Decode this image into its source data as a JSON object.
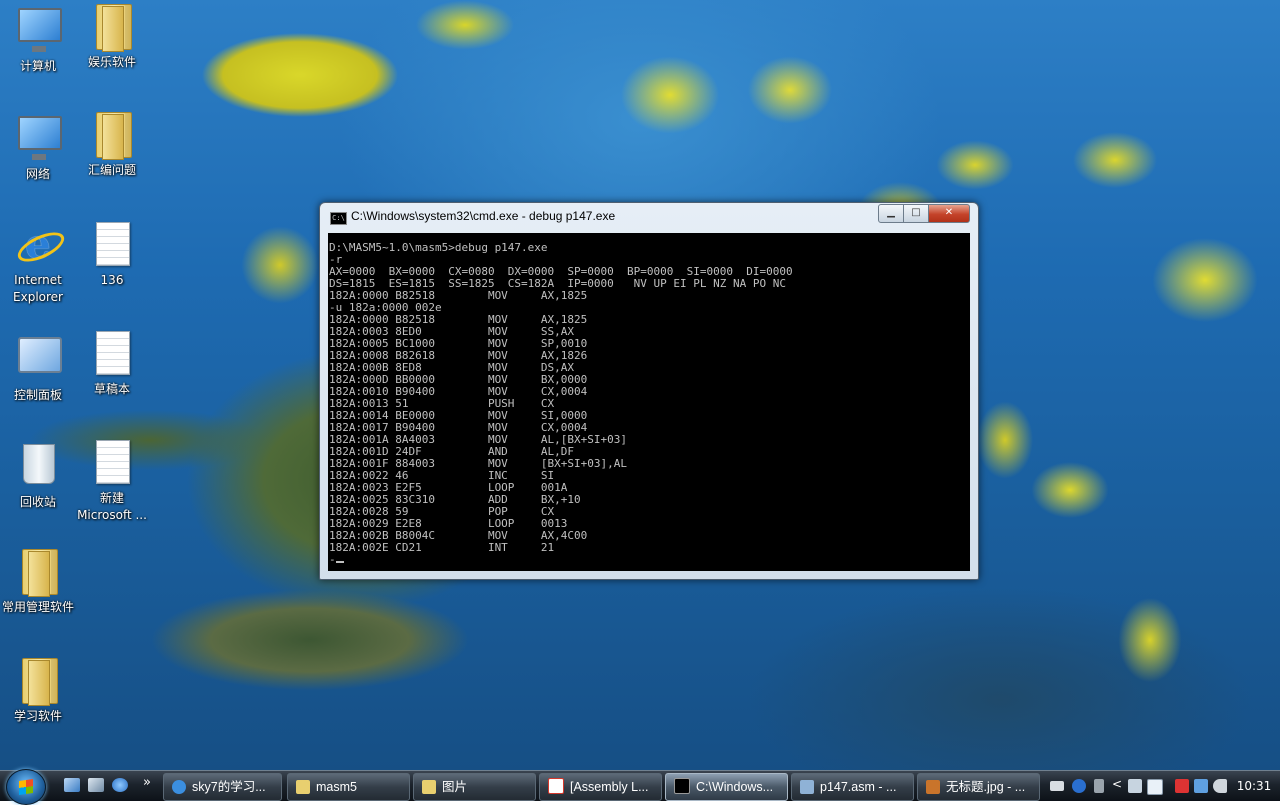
{
  "desktop": {
    "icons": [
      {
        "label": "计算机",
        "kind": "computer-icon"
      },
      {
        "label": "娱乐软件",
        "kind": "folder-icon"
      },
      {
        "label": "网络",
        "kind": "network-icon"
      },
      {
        "label": "汇编问题",
        "kind": "folder-icon"
      },
      {
        "label": "Internet Explorer",
        "kind": "internet-explorer-icon"
      },
      {
        "label": "136",
        "kind": "document-icon"
      },
      {
        "label": "控制面板",
        "kind": "control-panel-icon"
      },
      {
        "label": "草稿本",
        "kind": "document-icon"
      },
      {
        "label": "回收站",
        "kind": "recycle-bin-icon"
      },
      {
        "label": "新建 Microsoft ...",
        "kind": "word-document-icon"
      },
      {
        "label": "常用管理软件",
        "kind": "folder-icon"
      },
      {
        "label": "学习软件",
        "kind": "folder-icon"
      }
    ]
  },
  "cmd_window": {
    "title": "C:\\Windows\\system32\\cmd.exe - debug  p147.exe",
    "minimize_glyph": "▁",
    "maximize_glyph": "□",
    "close_glyph": "✕",
    "console_lines": [
      "D:\\MASM5~1.0\\masm5>debug p147.exe",
      "-r",
      "AX=0000  BX=0000  CX=0080  DX=0000  SP=0000  BP=0000  SI=0000  DI=0000",
      "DS=1815  ES=1815  SS=1825  CS=182A  IP=0000   NV UP EI PL NZ NA PO NC",
      "182A:0000 B82518        MOV     AX,1825",
      "-u 182a:0000 002e",
      "182A:0000 B82518        MOV     AX,1825",
      "182A:0003 8ED0          MOV     SS,AX",
      "182A:0005 BC1000        MOV     SP,0010",
      "182A:0008 B82618        MOV     AX,1826",
      "182A:000B 8ED8          MOV     DS,AX",
      "182A:000D BB0000        MOV     BX,0000",
      "182A:0010 B90400        MOV     CX,0004",
      "182A:0013 51            PUSH    CX",
      "182A:0014 BE0000        MOV     SI,0000",
      "182A:0017 B90400        MOV     CX,0004",
      "182A:001A 8A4003        MOV     AL,[BX+SI+03]",
      "182A:001D 24DF          AND     AL,DF",
      "182A:001F 884003        MOV     [BX+SI+03],AL",
      "182A:0022 46            INC     SI",
      "182A:0023 E2F5          LOOP    001A",
      "182A:0025 83C310        ADD     BX,+10",
      "182A:0028 59            POP     CX",
      "182A:0029 E2E8          LOOP    0013",
      "182A:002B B8004C        MOV     AX,4C00",
      "182A:002E CD21          INT     21",
      "-"
    ]
  },
  "taskbar": {
    "tasks": [
      {
        "label": "sky7的学习...",
        "color": "#3b8fe0"
      },
      {
        "label": "masm5",
        "color": "#e8cf6f"
      },
      {
        "label": "图片",
        "color": "#e8cf6f"
      },
      {
        "label": "[Assembly L...",
        "color": "#d4382c"
      },
      {
        "label": "C:\\Windows...",
        "color": "#000000",
        "active": true
      },
      {
        "label": "p147.asm - ...",
        "color": "#8fb2d6"
      },
      {
        "label": "无标题.jpg - ...",
        "color": "#c9742b"
      }
    ],
    "quicklaunch_more": "»",
    "clock": "10:31"
  },
  "colors": {
    "console_bg": "#000000",
    "console_fg": "#c0c0c0",
    "taskbar_bg": "#1c232c"
  }
}
